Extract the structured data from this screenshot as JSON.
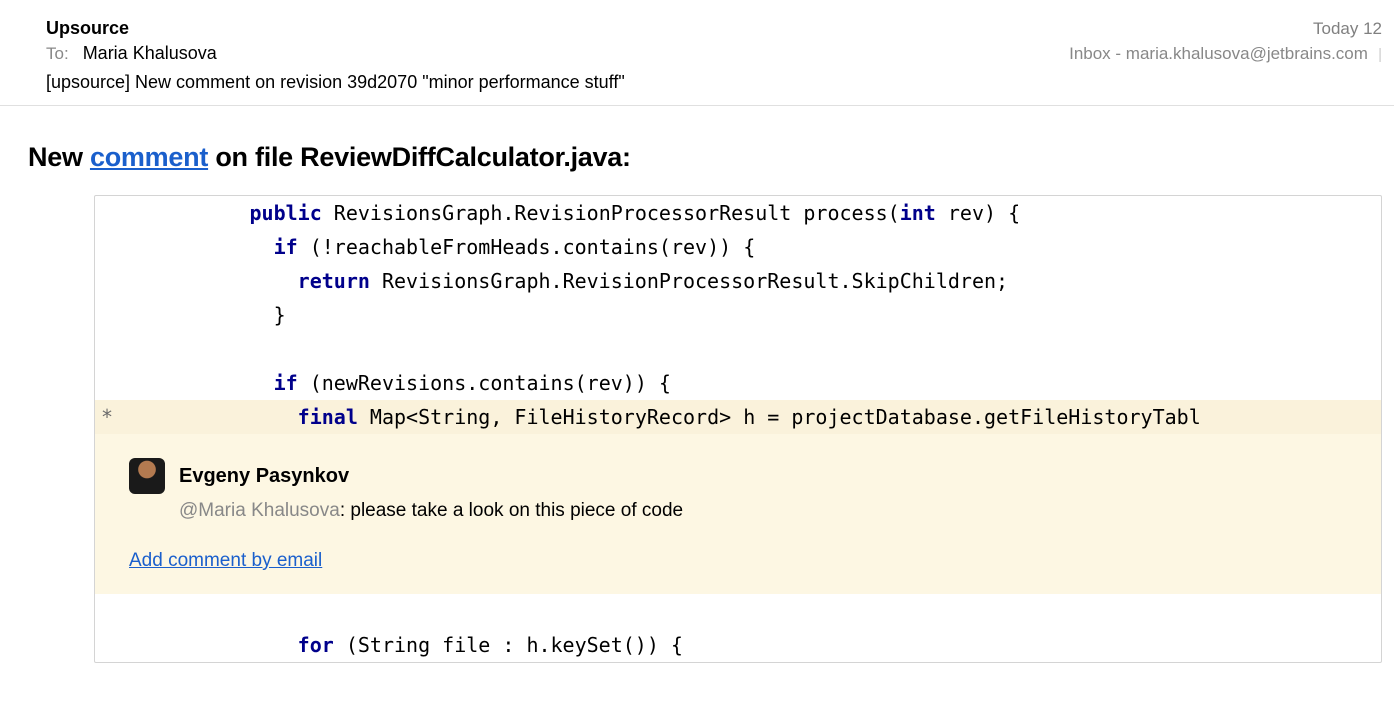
{
  "email": {
    "sender": "Upsource",
    "timestamp": "Today 12",
    "to_label": "To:",
    "recipient": "Maria Khalusova",
    "mailbox": "Inbox - maria.khalusova@jetbrains.com",
    "subject": "[upsource] New comment on revision 39d2070 \"minor performance stuff\""
  },
  "heading": {
    "prefix": "New ",
    "link": "comment",
    "suffix": " on file ReviewDiffCalculator.java:"
  },
  "code": {
    "lines": [
      {
        "indent": "            ",
        "tokens": [
          {
            "t": "public",
            "k": true
          },
          {
            "t": " RevisionsGraph.RevisionProcessorResult process("
          },
          {
            "t": "int",
            "k": true
          },
          {
            "t": " rev) {"
          }
        ]
      },
      {
        "indent": "              ",
        "tokens": [
          {
            "t": "if",
            "k": true
          },
          {
            "t": " (!reachableFromHeads.contains(rev)) {"
          }
        ]
      },
      {
        "indent": "                ",
        "tokens": [
          {
            "t": "return",
            "k": true
          },
          {
            "t": " RevisionsGraph.RevisionProcessorResult.SkipChildren;"
          }
        ]
      },
      {
        "indent": "              ",
        "tokens": [
          {
            "t": "}"
          }
        ]
      },
      {
        "indent": "",
        "tokens": [
          {
            "t": " "
          }
        ]
      },
      {
        "indent": "              ",
        "tokens": [
          {
            "t": "if",
            "k": true
          },
          {
            "t": " (newRevisions.contains(rev)) {"
          }
        ]
      },
      {
        "indent": "                ",
        "highlighted": true,
        "star": "*",
        "tokens": [
          {
            "t": "final",
            "k": true
          },
          {
            "t": " Map<String, FileHistoryRecord> h = projectDatabase.getFileHistoryTabl"
          }
        ]
      }
    ],
    "after_comment_line": {
      "indent": "                ",
      "tokens": [
        {
          "t": "for",
          "k": true
        },
        {
          "t": " (String file : h.keySet()) {"
        }
      ]
    }
  },
  "comment": {
    "author": "Evgeny Pasynkov",
    "mention": "@Maria Khalusova",
    "colon": ":  ",
    "text": "please take a look on this piece of code",
    "add_link": "Add comment by email"
  }
}
